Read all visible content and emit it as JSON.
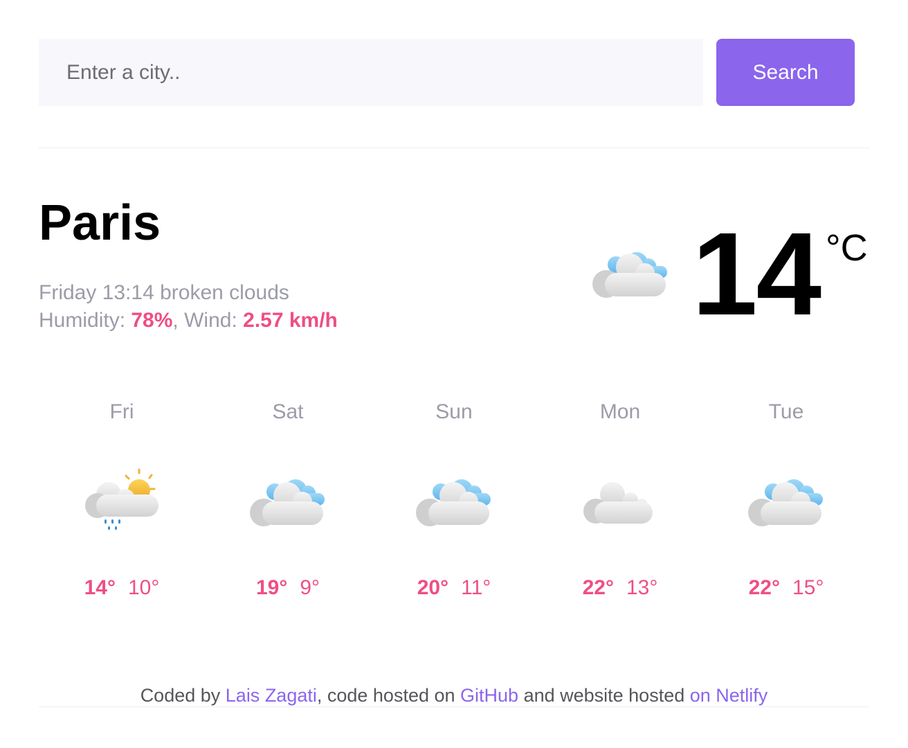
{
  "search": {
    "placeholder": "Enter a city..",
    "value": "",
    "button_label": "Search"
  },
  "current": {
    "city": "Paris",
    "day_time": "Friday 13:14",
    "description": "broken clouds",
    "humidity_label": "Humidity:",
    "humidity_value": "78%",
    "wind_label": "Wind:",
    "wind_value": "2.57 km/h",
    "temperature": "14",
    "unit": "°C",
    "icon": "broken-clouds-icon"
  },
  "forecast": [
    {
      "day": "Fri",
      "max": "14°",
      "min": "10°",
      "icon": "rain-sun-clouds-icon"
    },
    {
      "day": "Sat",
      "max": "19°",
      "min": "9°",
      "icon": "broken-clouds-icon"
    },
    {
      "day": "Sun",
      "max": "20°",
      "min": "11°",
      "icon": "broken-clouds-icon"
    },
    {
      "day": "Mon",
      "max": "22°",
      "min": "13°",
      "icon": "scattered-clouds-icon"
    },
    {
      "day": "Tue",
      "max": "22°",
      "min": "15°",
      "icon": "broken-clouds-icon"
    }
  ],
  "footer": {
    "text_1": "Coded by ",
    "author_link": "Lais Zagati",
    "text_2": ", code hosted on ",
    "github_link": "GitHub",
    "text_3": " and website hosted ",
    "netlify_link": "on Netlify"
  },
  "colors": {
    "accent": "#8b65ec",
    "highlight": "#ef4e84",
    "muted": "#9b9ca8",
    "input_bg": "#f7f7fc"
  }
}
